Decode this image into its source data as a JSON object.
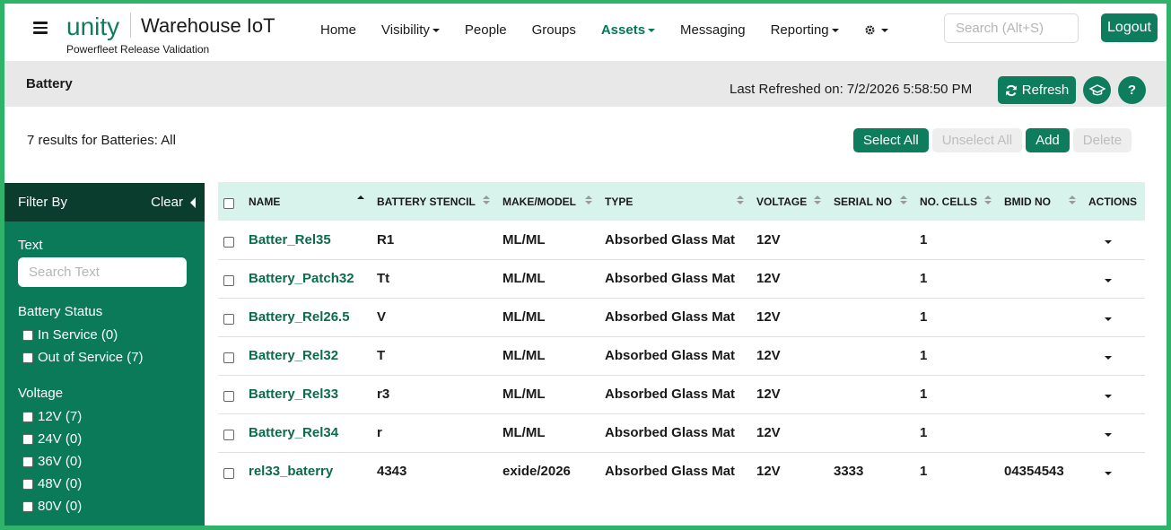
{
  "header": {
    "brand": "unity",
    "app_title": "Warehouse IoT",
    "subtitle": "Powerfleet Release Validation",
    "accent": "#0d7d5e",
    "nav": [
      {
        "label": "Home",
        "dropdown": false,
        "active": false
      },
      {
        "label": "Visibility",
        "dropdown": true,
        "active": false
      },
      {
        "label": "People",
        "dropdown": false,
        "active": false
      },
      {
        "label": "Groups",
        "dropdown": false,
        "active": false
      },
      {
        "label": "Assets",
        "dropdown": true,
        "active": true
      },
      {
        "label": "Messaging",
        "dropdown": false,
        "active": false
      },
      {
        "label": "Reporting",
        "dropdown": true,
        "active": false
      }
    ],
    "settings_icon": "gear-icon",
    "search_placeholder": "Search (Alt+S)",
    "logout_label": "Logout"
  },
  "page": {
    "title": "Battery",
    "last_refreshed": "Last Refreshed on: 7/2/2026 5:58:50 PM",
    "refresh_label": "Refresh",
    "help_label": "?"
  },
  "results": {
    "summary": "7 results for Batteries: All",
    "buttons": [
      {
        "label": "Select All",
        "enabled": true
      },
      {
        "label": "Unselect All",
        "enabled": false
      },
      {
        "label": "Add",
        "enabled": true
      },
      {
        "label": "Delete",
        "enabled": false
      }
    ]
  },
  "sidebar": {
    "title": "Filter By",
    "clear_label": "Clear",
    "text_label": "Text",
    "text_placeholder": "Search Text",
    "groups": [
      {
        "label": "Battery Status",
        "options": [
          "In Service (0)",
          "Out of Service (7)"
        ]
      },
      {
        "label": "Voltage",
        "options": [
          "12V (7)",
          "24V (0)",
          "36V (0)",
          "48V (0)",
          "80V (0)"
        ]
      }
    ]
  },
  "table": {
    "columns": [
      "NAME",
      "BATTERY STENCIL",
      "MAKE/MODEL",
      "TYPE",
      "VOLTAGE",
      "SERIAL NO",
      "NO. CELLS",
      "BMID NO",
      "ACTIONS"
    ],
    "rows": [
      [
        "Batter_Rel35",
        "R1",
        "ML/ML",
        "Absorbed Glass Mat",
        "12V",
        "",
        "1",
        ""
      ],
      [
        "Battery_Patch32",
        "Tt",
        "ML/ML",
        "Absorbed Glass Mat",
        "12V",
        "",
        "1",
        ""
      ],
      [
        "Battery_Rel26.5",
        "V",
        "ML/ML",
        "Absorbed Glass Mat",
        "12V",
        "",
        "1",
        ""
      ],
      [
        "Battery_Rel32",
        "T",
        "ML/ML",
        "Absorbed Glass Mat",
        "12V",
        "",
        "1",
        ""
      ],
      [
        "Battery_Rel33",
        "r3",
        "ML/ML",
        "Absorbed Glass Mat",
        "12V",
        "",
        "1",
        ""
      ],
      [
        "Battery_Rel34",
        "r",
        "ML/ML",
        "Absorbed Glass Mat",
        "12V",
        "",
        "1",
        ""
      ],
      [
        "rel33_baterry",
        "4343",
        "exide/2026",
        "Absorbed Glass Mat",
        "12V",
        "3333",
        "1",
        "04354543"
      ]
    ]
  }
}
